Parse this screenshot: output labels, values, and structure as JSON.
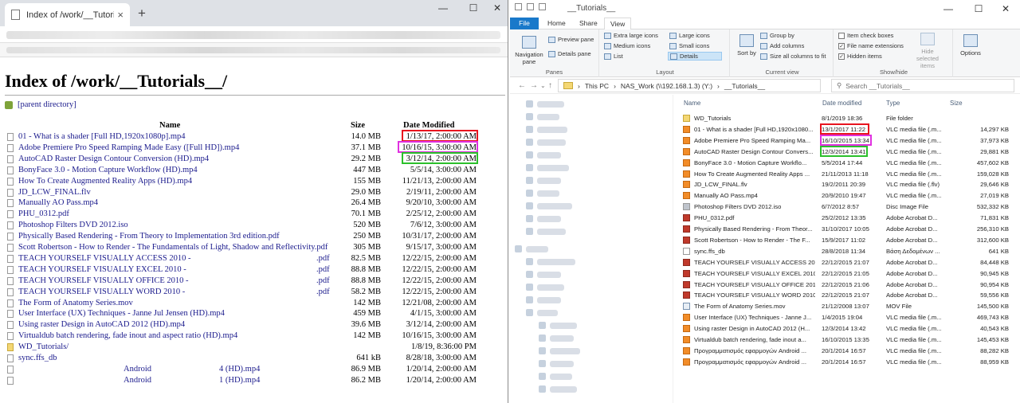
{
  "browser": {
    "tab_title": "Index of /work/__Tutorials__/",
    "tab_close": "×",
    "new_tab": "+",
    "win_min": "—",
    "win_max": "☐",
    "win_close": "✕",
    "heading": "Index of /work/__Tutorials__/",
    "parent_label": "[parent directory]",
    "columns": {
      "name": "Name",
      "size": "Size",
      "date": "Date Modified"
    },
    "rows": [
      {
        "name": "01 - What is a shader [Full HD,1920x1080p].mp4",
        "size": "14.0 MB",
        "date": "1/13/17, 2:00:00 AM",
        "icon": "file"
      },
      {
        "name": "Adobe Premiere Pro Speed Ramping Made Easy ([Full HD]).mp4",
        "size": "37.1 MB",
        "date": "10/16/15, 3:00:00 AM",
        "icon": "file"
      },
      {
        "name": "AutoCAD Raster Design Contour Conversion (HD).mp4",
        "size": "29.2 MB",
        "date": "3/12/14, 2:00:00 AM",
        "icon": "file"
      },
      {
        "name": "BonyFace 3.0 - Motion Capture Workflow (HD).mp4",
        "size": "447 MB",
        "date": "5/5/14, 3:00:00 AM",
        "icon": "file"
      },
      {
        "name": "How To Create Augmented Reality Apps (HD).mp4",
        "size": "155 MB",
        "date": "11/21/13, 2:00:00 AM",
        "icon": "file"
      },
      {
        "name": "JD_LCW_FINAL.flv",
        "size": "29.0 MB",
        "date": "2/19/11, 2:00:00 AM",
        "icon": "file"
      },
      {
        "name": "Manually AO Pass.mp4",
        "size": "26.4 MB",
        "date": "9/20/10, 3:00:00 AM",
        "icon": "file"
      },
      {
        "name": "PHU_0312.pdf",
        "size": "70.1 MB",
        "date": "2/25/12, 2:00:00 AM",
        "icon": "file"
      },
      {
        "name": "Photoshop Filters DVD 2012.iso",
        "size": "520 MB",
        "date": "7/6/12, 3:00:00 AM",
        "icon": "file"
      },
      {
        "name": "Physically Based Rendering - From Theory to Implementation 3rd edition.pdf",
        "size": "250 MB",
        "date": "10/31/17, 2:00:00 AM",
        "icon": "file"
      },
      {
        "name": "Scott Robertson - How to Render - The Fundamentals of Light, Shadow and Reflectivity.pdf",
        "size": "305 MB",
        "date": "9/15/17, 3:00:00 AM",
        "icon": "file"
      },
      {
        "name": "TEACH YOURSELF VISUALLY ACCESS 2010 -",
        "ext": ".pdf",
        "size": "82.5 MB",
        "date": "12/22/15, 2:00:00 AM",
        "icon": "file"
      },
      {
        "name": "TEACH YOURSELF VISUALLY EXCEL 2010 -",
        "ext": ".pdf",
        "size": "88.8 MB",
        "date": "12/22/15, 2:00:00 AM",
        "icon": "file"
      },
      {
        "name": "TEACH YOURSELF VISUALLY OFFICE 2010 -",
        "ext": ".pdf",
        "size": "88.8 MB",
        "date": "12/22/15, 2:00:00 AM",
        "icon": "file"
      },
      {
        "name": "TEACH YOURSELF VISUALLY WORD 2010 -",
        "ext": ".pdf",
        "size": "58.2 MB",
        "date": "12/22/15, 2:00:00 AM",
        "icon": "file"
      },
      {
        "name": "The Form of Anatomy Series.mov",
        "size": "142 MB",
        "date": "12/21/08, 2:00:00 AM",
        "icon": "file"
      },
      {
        "name": "User Interface (UX) Techniques - Janne Jul Jensen (HD).mp4",
        "size": "459 MB",
        "date": "4/1/15, 3:00:00 AM",
        "icon": "file"
      },
      {
        "name": "Using raster Design in AutoCAD 2012 (HD).mp4",
        "size": "39.6 MB",
        "date": "3/12/14, 2:00:00 AM",
        "icon": "file"
      },
      {
        "name": "Virtualdub batch rendering, fade inout and aspect ratio (HD).mp4",
        "size": "142 MB",
        "date": "10/16/15, 3:00:00 AM",
        "icon": "file"
      },
      {
        "name": "WD_Tutorials/",
        "size": "",
        "date": "1/8/19, 8:36:00 PM",
        "icon": "folder"
      },
      {
        "name": "sync.ffs_db",
        "size": "641 kB",
        "date": "8/28/18, 3:00:00 AM",
        "icon": "file"
      },
      {
        "name": "Android",
        "ext": "4 (HD).mp4",
        "size": "86.9 MB",
        "date": "1/20/14, 2:00:00 AM",
        "icon": "file",
        "indent": true
      },
      {
        "name": "Android",
        "ext": "1 (HD).mp4",
        "size": "86.2 MB",
        "date": "1/20/14, 2:00:00 AM",
        "icon": "file",
        "indent": true
      }
    ]
  },
  "explorer": {
    "title": "__Tutorials__",
    "tabs": {
      "file": "File",
      "home": "Home",
      "share": "Share",
      "view": "View"
    },
    "ribbon": {
      "navigation_pane": "Navigation pane",
      "preview_pane": "Preview pane",
      "details_pane": "Details pane",
      "panes_label": "Panes",
      "extra_large_icons": "Extra large icons",
      "large_icons": "Large icons",
      "medium_icons": "Medium icons",
      "small_icons": "Small icons",
      "list": "List",
      "details": "Details",
      "layout_label": "Layout",
      "sort_by": "Sort by",
      "group_by": "Group by",
      "add_columns": "Add columns",
      "size_all_columns": "Size all columns to fit",
      "current_view_label": "Current view",
      "item_check_boxes": "Item check boxes",
      "file_name_extensions": "File name extensions",
      "hidden_items": "Hidden items",
      "hide_selected_items": "Hide selected items",
      "show_hide_label": "Show/hide",
      "options": "Options"
    },
    "breadcrumb": [
      "This PC",
      "NAS_Work (\\\\192.168.1.3) (Y:)",
      "__Tutorials__"
    ],
    "search_placeholder": "Search __Tutorials__",
    "columns": {
      "name": "Name",
      "date": "Date modified",
      "type": "Type",
      "size": "Size"
    },
    "rows": [
      {
        "name": "WD_Tutorials",
        "date": "8/1/2019 18:36",
        "type": "File folder",
        "size": "",
        "icon": "folder"
      },
      {
        "name": "01 - What is a shader [Full HD,1920x1080...",
        "date": "13/1/2017 11:22",
        "type": "VLC media file (.m...",
        "size": "14,297 KB",
        "icon": "vlc"
      },
      {
        "name": "Adobe Premiere Pro Speed Ramping Ma...",
        "date": "16/10/2015 13:34",
        "type": "VLC media file (.m...",
        "size": "37,973 KB",
        "icon": "vlc"
      },
      {
        "name": "AutoCAD Raster Design Contour Convers...",
        "date": "12/3/2014 13:41",
        "type": "VLC media file (.m...",
        "size": "29,881 KB",
        "icon": "vlc"
      },
      {
        "name": "BonyFace 3.0 - Motion Capture Workflo...",
        "date": "5/5/2014 17:44",
        "type": "VLC media file (.m...",
        "size": "457,602 KB",
        "icon": "vlc"
      },
      {
        "name": "How To Create Augmented Reality Apps ...",
        "date": "21/11/2013 11:18",
        "type": "VLC media file (.m...",
        "size": "159,028 KB",
        "icon": "vlc"
      },
      {
        "name": "JD_LCW_FINAL.flv",
        "date": "19/2/2011 20:39",
        "type": "VLC media file (.flv)",
        "size": "29,646 KB",
        "icon": "vlc"
      },
      {
        "name": "Manually AO Pass.mp4",
        "date": "20/9/2010 19:47",
        "type": "VLC media file (.m...",
        "size": "27,019 KB",
        "icon": "vlc"
      },
      {
        "name": "Photoshop Filters DVD 2012.iso",
        "date": "6/7/2012 8:57",
        "type": "Disc Image File",
        "size": "532,332 KB",
        "icon": "iso"
      },
      {
        "name": "PHU_0312.pdf",
        "date": "25/2/2012 13:35",
        "type": "Adobe Acrobat D...",
        "size": "71,831 KB",
        "icon": "pdf"
      },
      {
        "name": "Physically Based Rendering - From Theor...",
        "date": "31/10/2017 10:05",
        "type": "Adobe Acrobat D...",
        "size": "256,310 KB",
        "icon": "pdf"
      },
      {
        "name": "Scott Robertson - How to Render - The F...",
        "date": "15/9/2017 11:02",
        "type": "Adobe Acrobat D...",
        "size": "312,600 KB",
        "icon": "pdf"
      },
      {
        "name": "sync.ffs_db",
        "date": "28/8/2018 11:34",
        "type": "Βάση Δεδομένων ...",
        "size": "641 KB",
        "icon": "file"
      },
      {
        "name": "TEACH YOURSELF VISUALLY ACCESS 2010 ...",
        "date": "22/12/2015 21:07",
        "type": "Adobe Acrobat D...",
        "size": "84,448 KB",
        "icon": "pdf"
      },
      {
        "name": "TEACH YOURSELF VISUALLY EXCEL 2010 ...",
        "date": "22/12/2015 21:05",
        "type": "Adobe Acrobat D...",
        "size": "90,945 KB",
        "icon": "pdf"
      },
      {
        "name": "TEACH YOURSELF VISUALLY OFFICE 2010 ...",
        "date": "22/12/2015 21:06",
        "type": "Adobe Acrobat D...",
        "size": "90,954 KB",
        "icon": "pdf"
      },
      {
        "name": "TEACH YOURSELF VISUALLY WORD 2010 ...",
        "date": "22/12/2015 21:07",
        "type": "Adobe Acrobat D...",
        "size": "59,556 KB",
        "icon": "pdf"
      },
      {
        "name": "The Form of Anatomy Series.mov",
        "date": "21/12/2008 13:07",
        "type": "MOV File",
        "size": "145,500 KB",
        "icon": "mov"
      },
      {
        "name": "User Interface (UX) Techniques - Janne J...",
        "date": "1/4/2015 19:04",
        "type": "VLC media file (.m...",
        "size": "469,743 KB",
        "icon": "vlc"
      },
      {
        "name": "Using raster Design in AutoCAD 2012 (H...",
        "date": "12/3/2014 13:42",
        "type": "VLC media file (.m...",
        "size": "40,543 KB",
        "icon": "vlc"
      },
      {
        "name": "Virtualdub batch rendering, fade inout a...",
        "date": "16/10/2015 13:35",
        "type": "VLC media file (.m...",
        "size": "145,453 KB",
        "icon": "vlc"
      },
      {
        "name": "Προγραμματισμός εφαρμογών Android ...",
        "date": "20/1/2014 16:57",
        "type": "VLC media file (.m...",
        "size": "88,282 KB",
        "icon": "vlc"
      },
      {
        "name": "Προγραμματισμός εφαρμογών Android ...",
        "date": "20/1/2014 16:57",
        "type": "VLC media file (.m...",
        "size": "88,959 KB",
        "icon": "vlc"
      }
    ]
  },
  "highlight_colors": {
    "red": "#e8141f",
    "magenta": "#e030e0",
    "green": "#2bc02b"
  }
}
